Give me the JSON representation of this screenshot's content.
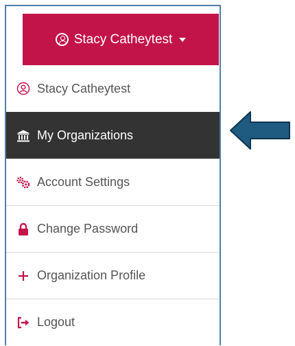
{
  "header": {
    "user_name": "Stacy Catheytest",
    "icon": "user-circle-icon",
    "caret_icon": "caret-down-icon",
    "accent_color": "#c3144a"
  },
  "menu": {
    "items": [
      {
        "label": "Stacy Catheytest",
        "icon": "user-circle-icon"
      },
      {
        "label": "My Organizations",
        "icon": "bank-icon",
        "active": true
      },
      {
        "label": "Account Settings",
        "icon": "gears-icon"
      },
      {
        "label": "Change Password",
        "icon": "lock-icon"
      },
      {
        "label": "Organization Profile",
        "icon": "plus-icon"
      },
      {
        "label": "Logout",
        "icon": "logout-icon"
      }
    ],
    "active_bg": "#333333",
    "icon_color": "#c3144a"
  },
  "annotation": {
    "icon": "left-arrow-icon",
    "color": "#1f5a80"
  }
}
